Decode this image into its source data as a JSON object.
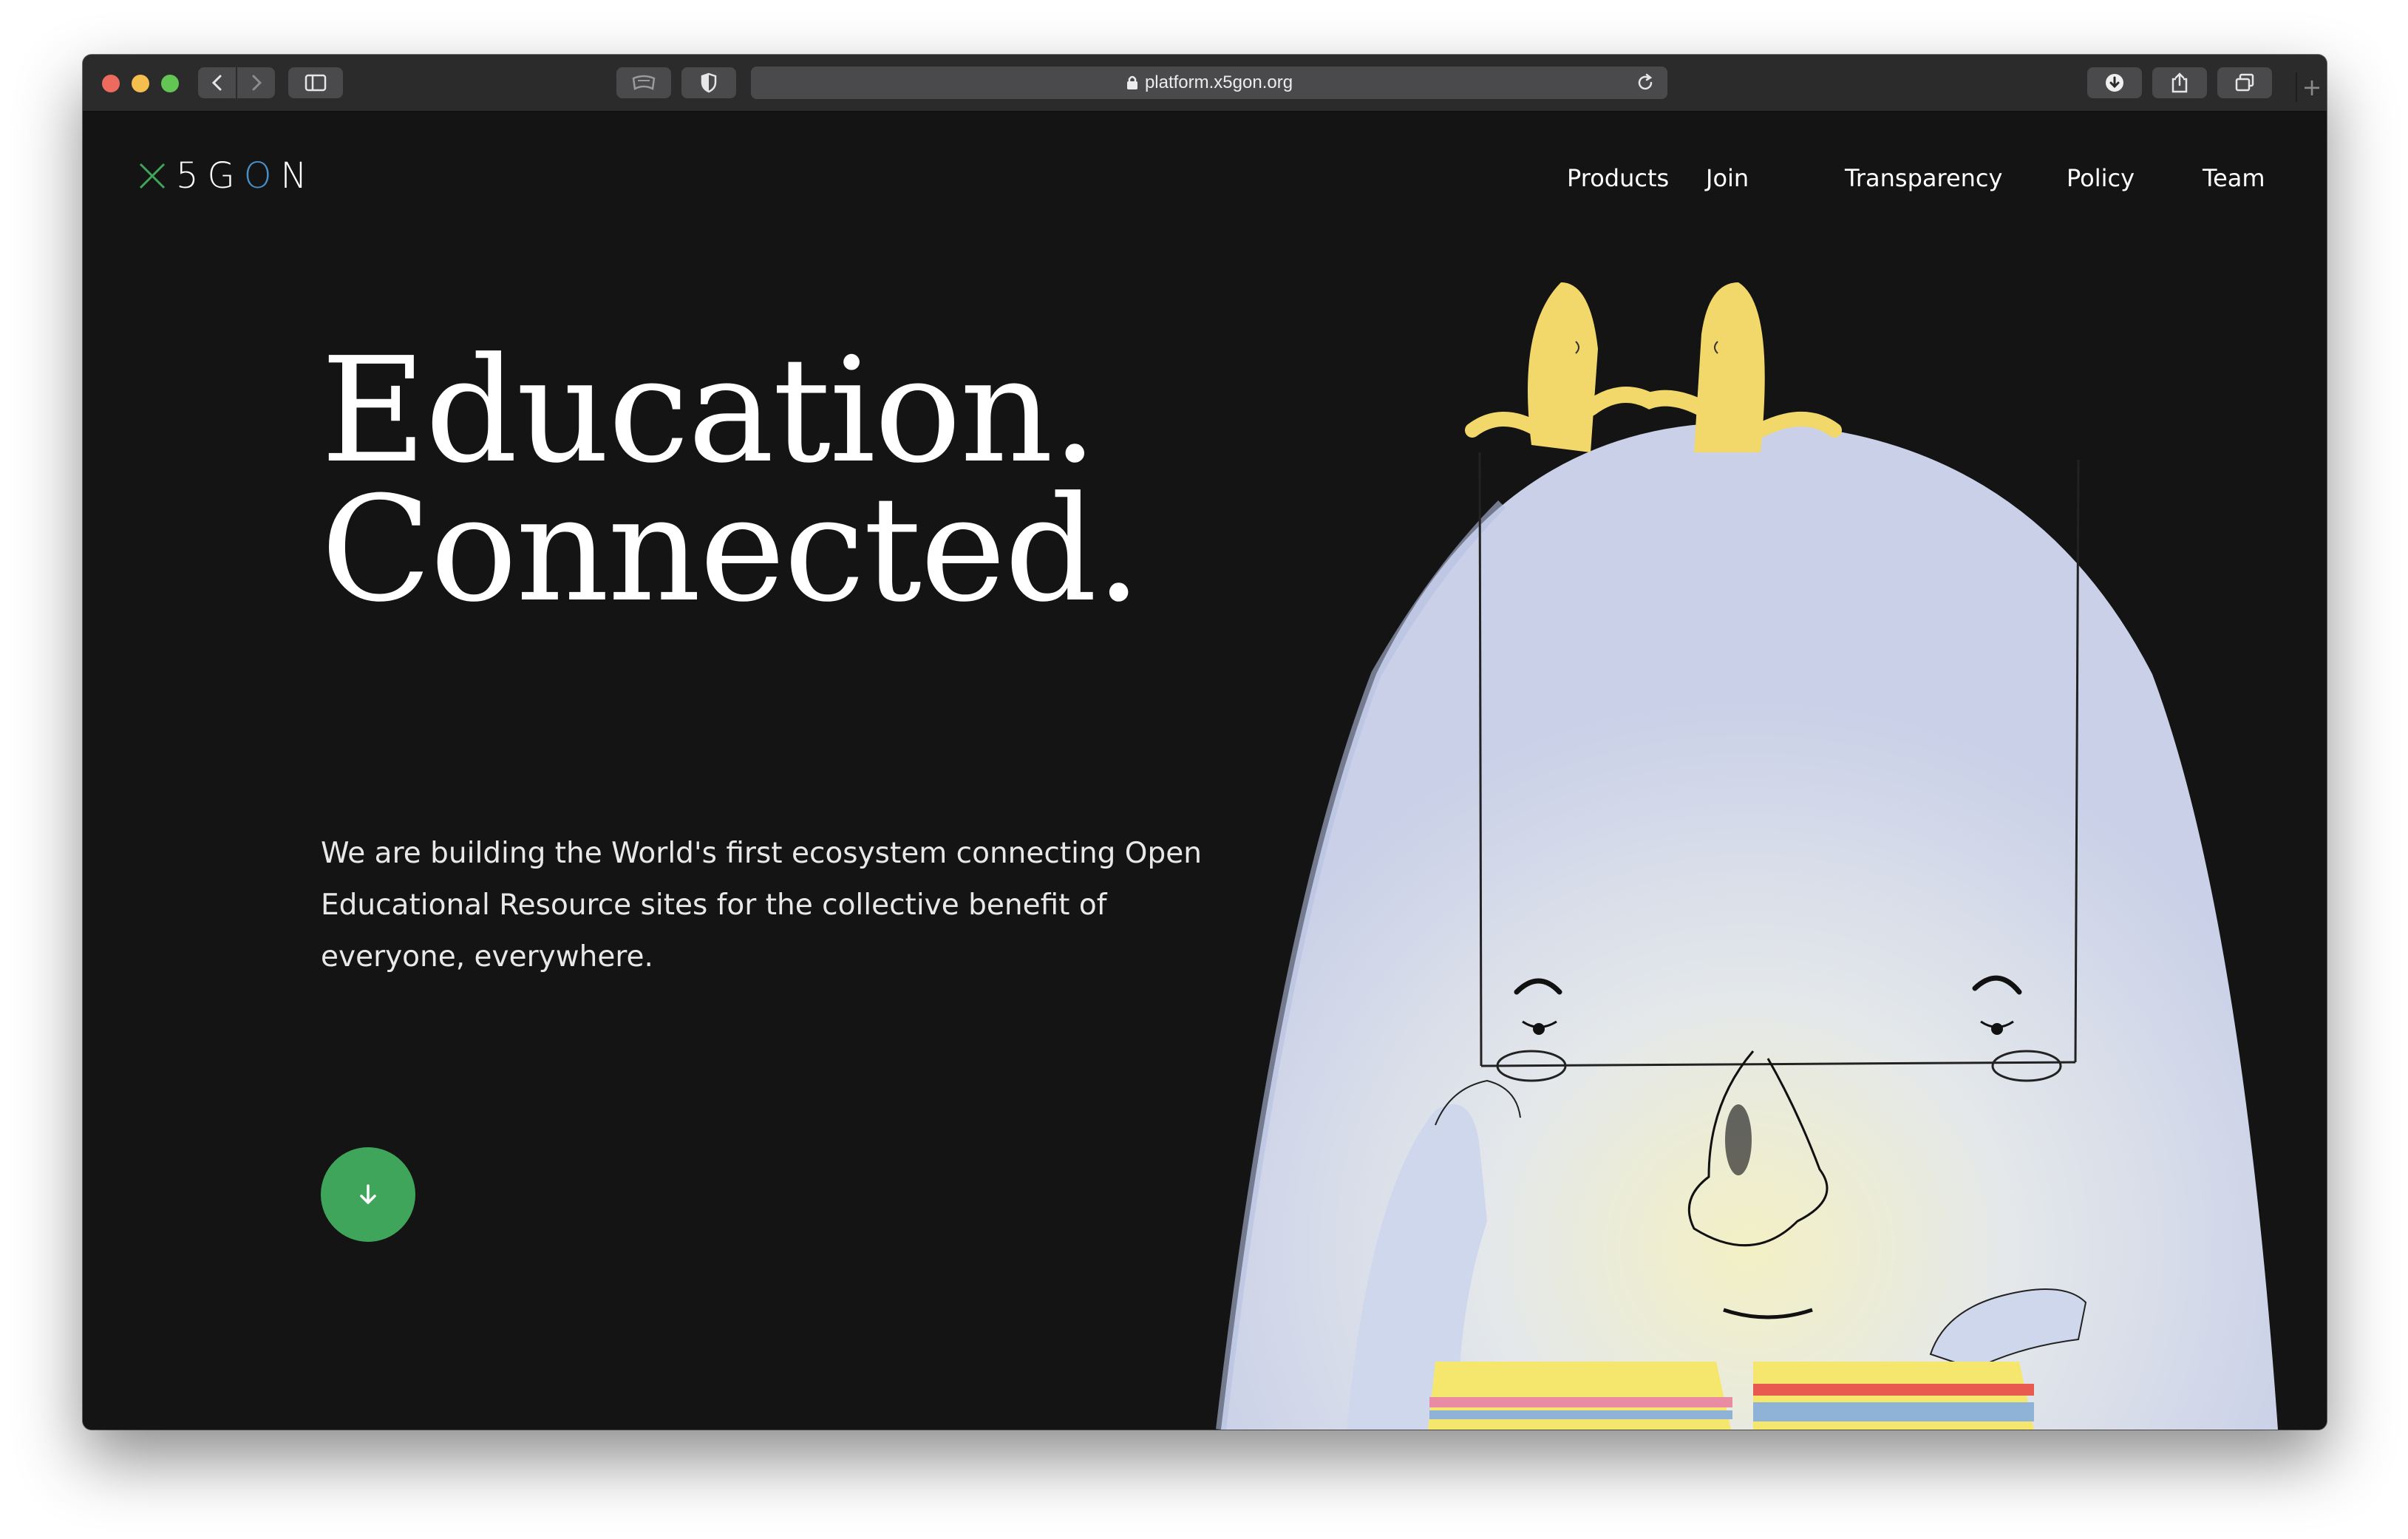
{
  "browser": {
    "url": "platform.x5gon.org",
    "buttons": {
      "back_icon": "chevron-left-icon",
      "forward_icon": "chevron-right-icon",
      "sidebar_icon": "sidebar-icon",
      "reader_icon": "reader-icon",
      "privacy_icon": "shield-icon",
      "reload_icon": "reload-icon",
      "downloads_icon": "download-icon",
      "share_icon": "share-icon",
      "tabs_icon": "tabs-icon",
      "newtab_label": "+"
    }
  },
  "site": {
    "logo": {
      "x": "X",
      "five": "5",
      "g": "G",
      "o": "O",
      "n": "N"
    },
    "nav": [
      "Products",
      "Join",
      "Transparency",
      "Policy",
      "Team"
    ],
    "hero": {
      "title_line1": "Education.",
      "title_line2": "Connected.",
      "description": "We are building the World's first ecosystem connecting Open Educational Resource sites for the collective benefit of everyone, everywhere."
    },
    "scroll_button_icon": "arrow-down-icon"
  },
  "colors": {
    "background": "#141414",
    "accent_green": "#3fa55b",
    "logo_blue": "#4a90c8",
    "toolbar": "#2b2b2c"
  }
}
